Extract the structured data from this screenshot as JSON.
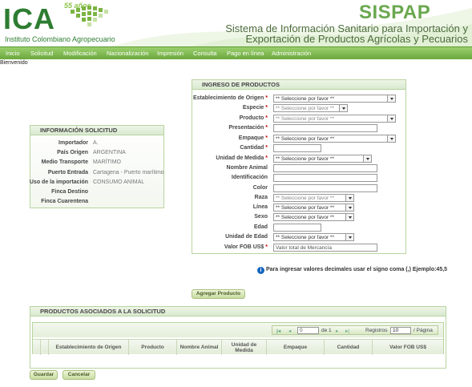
{
  "header": {
    "brand": "ICA",
    "anos": "55 años",
    "institute": "Instituto Colombiano Agropecuario",
    "app_name": "SISPAP",
    "system_line1": "Sistema de Información Sanitario para Importación y",
    "system_line2": "Exportación de Productos Agrícolas y Pecuarios"
  },
  "menu": [
    "Inicio",
    "Solicitud",
    "Modificación",
    "Nacionalización",
    "Impresión",
    "Consulta",
    "Pago en línea",
    "Administración"
  ],
  "welcome": "Bienvenido",
  "info": {
    "title": "INFORMACIÓN SOLICITUD",
    "rows": [
      {
        "label": "Importador",
        "value": "A."
      },
      {
        "label": "País Origen",
        "value": "ARGENTINA"
      },
      {
        "label": "Medio Transporte",
        "value": "MARÍTIMO"
      },
      {
        "label": "Puerto Entrada",
        "value": "Cartagena - Puerto marítimo"
      },
      {
        "label": "Uso de la importación",
        "value": "CONSUMO ANIMAL"
      },
      {
        "label": "Finca Destino",
        "value": ""
      },
      {
        "label": "Finca Cuarentena",
        "value": ""
      }
    ]
  },
  "ingreso": {
    "title": "INGRESO DE PRODUCTOS",
    "fields": {
      "establecimiento": {
        "label": "Establecimiento de Origen",
        "value": "** Seleccione por favor **"
      },
      "especie": {
        "label": "Especie",
        "value": "** Seleccione por favor **"
      },
      "producto": {
        "label": "Producto",
        "value": "** Seleccione por favor **"
      },
      "presentacion": {
        "label": "Presentación",
        "value": ""
      },
      "empaque": {
        "label": "Empaque",
        "value": "** Seleccione por favor **"
      },
      "cantidad": {
        "label": "Cantidad",
        "value": ""
      },
      "unidad_medida": {
        "label": "Unidad de Medida",
        "value": "** Seleccione por favor **"
      },
      "nombre_animal": {
        "label": "Nombre Animal",
        "value": ""
      },
      "identificacion": {
        "label": "Identificación",
        "value": ""
      },
      "color": {
        "label": "Color",
        "value": ""
      },
      "raza": {
        "label": "Raza",
        "value": "** Seleccione por favor **"
      },
      "linea": {
        "label": "Línea",
        "value": "** Seleccione por favor **"
      },
      "sexo": {
        "label": "Sexo",
        "value": "** Seleccione por favor **"
      },
      "edad": {
        "label": "Edad",
        "value": ""
      },
      "unidad_edad": {
        "label": "Unidad de Edad",
        "value": "** Seleccione por favor **"
      },
      "valor_fob": {
        "label": "Valor FOB US$",
        "placeholder": "Valor total de Mercancía"
      }
    }
  },
  "note": "Para ingresar valores decimales usar el signo coma (,) Ejemplo:45,5",
  "buttons": {
    "agregar": "Agregar Producto",
    "guardar": "Guardar",
    "cancelar": "Cancelar"
  },
  "productos": {
    "title": "PRODUCTOS ASOCIADOS A LA SOLICITUD",
    "pager": {
      "page": "0",
      "of_label": "de 1",
      "registros_label": "Registros",
      "registros_value": "10",
      "per_page": "/ Página"
    },
    "columns": [
      "Establecimiento de Origen",
      "Producto",
      "Nombre Animal",
      "Unidad de Medida",
      "Empaque",
      "Cantidad",
      "Valor FOB US$"
    ]
  },
  "colors": {
    "menu": "#7cb84a",
    "brand": "#2e7d32",
    "sispap": "#6aa84f",
    "required": "#cc0000"
  }
}
